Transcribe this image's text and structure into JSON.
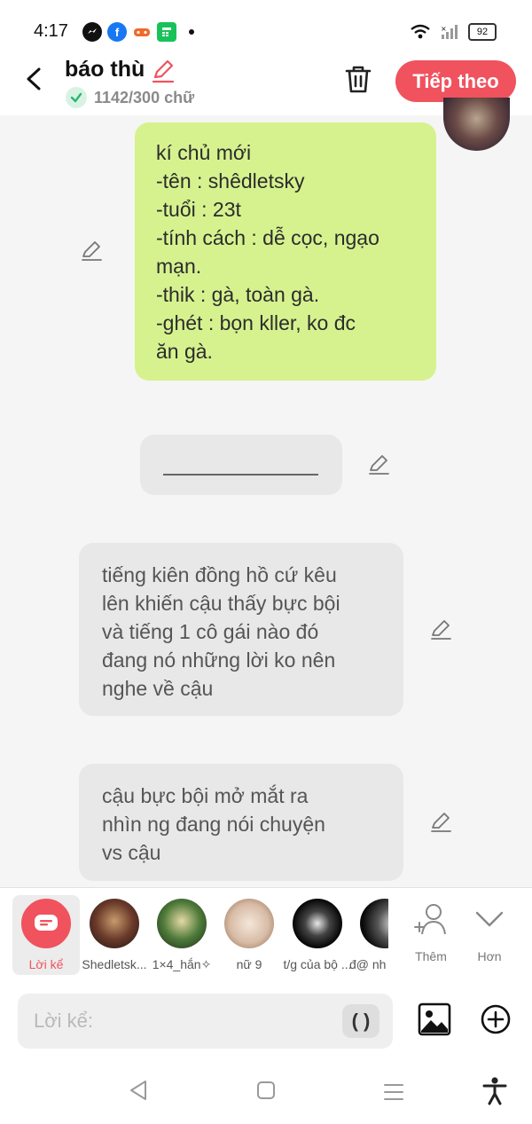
{
  "status_bar": {
    "time": "4:17",
    "battery": "92",
    "app_icons": [
      "messenger-icon",
      "facebook-icon",
      "game-icon",
      "calculator-icon"
    ]
  },
  "header": {
    "title": "báo thù",
    "word_count": "1142/300 chữ",
    "next_label": "Tiếp theo",
    "accent_color": "#f0525e"
  },
  "messages": {
    "character_card": [
      "kí chủ mới",
      "-tên : shêdletsky",
      "-tuổi : 23t",
      "-tính cách : dễ cọc, ngạo",
      "mạn.",
      "-thik : gà, toàn gà.",
      "-ghét : bọn kller, ko đc",
      "ăn gà."
    ],
    "narration_1": [
      "tiếng kiên đồng hồ cứ kêu",
      "lên khiến cậu thấy bực bội",
      "và tiếng 1 cô gái nào đó",
      "đang nó những lời ko nên",
      "nghe về cậu"
    ],
    "narration_2": [
      "cậu bực bội mở mắt ra",
      "nhìn ng đang nói chuyện",
      "vs cậu"
    ]
  },
  "characters": {
    "narrator_label": "Lời kể",
    "items": [
      {
        "name": "Shedletsk..."
      },
      {
        "name": "1×4_hắn✧"
      },
      {
        "name": "nữ 9"
      },
      {
        "name": "t/g của bộ ..."
      },
      {
        "name": "đ@ nh"
      }
    ],
    "add_label": "Thêm",
    "more_label": "Hơn"
  },
  "input": {
    "placeholder": "Lời kể:",
    "paren_button": "( )"
  }
}
